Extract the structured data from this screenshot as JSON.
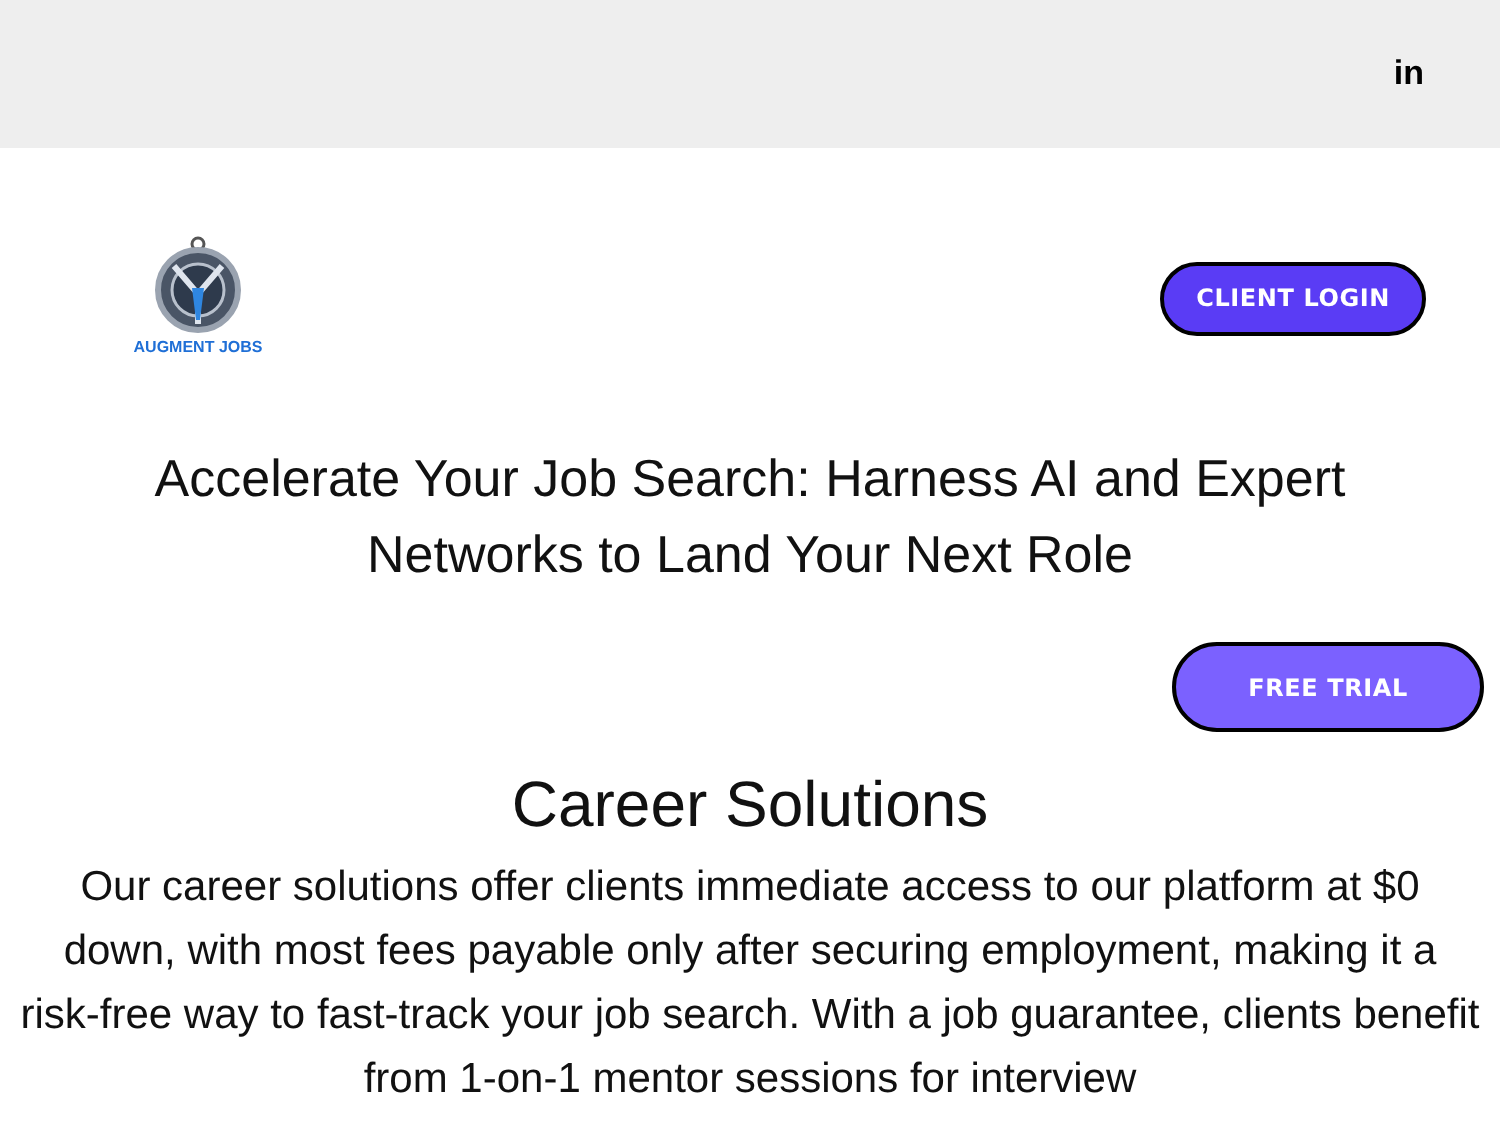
{
  "top_bar": {
    "social": "in"
  },
  "header": {
    "logo_text": "AUGMENT JOBS",
    "login_button": "CLIENT LOGIN"
  },
  "hero": {
    "headline": "Accelerate Your Job Search: Harness AI and Expert Networks to Land Your Next Role",
    "cta_button": "FREE TRIAL"
  },
  "section": {
    "title": "Career Solutions",
    "body": "Our career solutions offer clients immediate access to our platform at $0 down, with most fees payable only after securing employment, making it a risk-free way to fast-track your job search. With a job guarantee, clients benefit from 1-on-1 mentor sessions for interview"
  }
}
